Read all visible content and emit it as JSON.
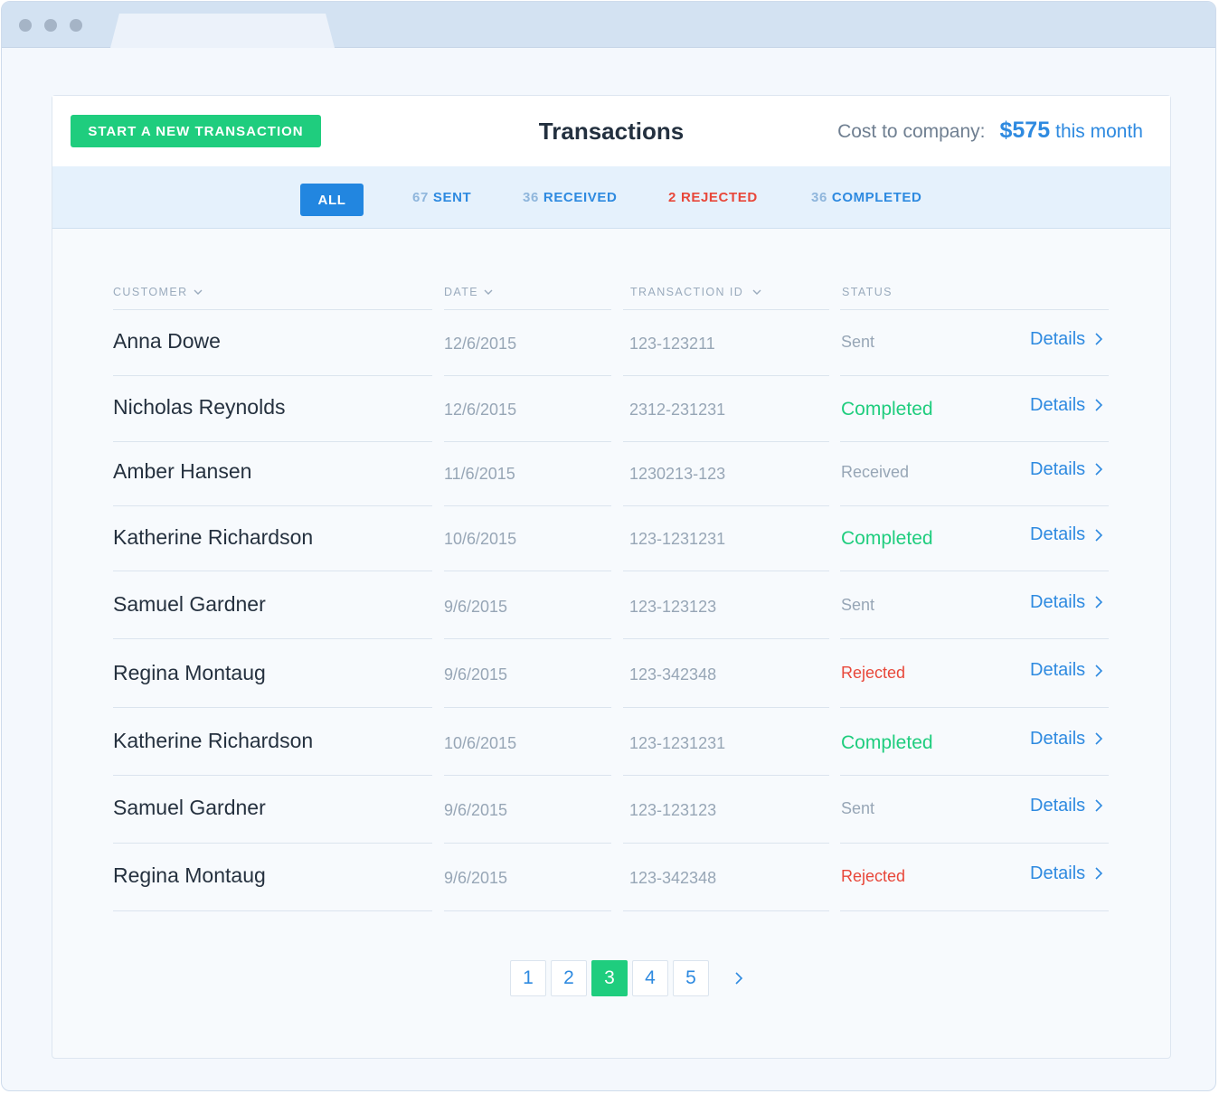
{
  "header": {
    "new_button": "START A NEW TRANSACTION",
    "title": "Transactions",
    "cost_label": "Cost to company:",
    "cost_amount": "$575",
    "cost_suffix": "this month"
  },
  "filters": {
    "all": "ALL",
    "sent": {
      "count": "67",
      "label": "SENT"
    },
    "received": {
      "count": "36",
      "label": "RECEIVED"
    },
    "rejected": {
      "count": "2",
      "label": "REJECTED"
    },
    "completed": {
      "count": "36",
      "label": "COMPLETED"
    }
  },
  "table": {
    "columns": {
      "customer": "CUSTOMER",
      "date": "DATE",
      "transaction_id": "TRANSACTION ID",
      "status": "STATUS"
    },
    "details_label": "Details",
    "rows": [
      {
        "customer": "Anna Dowe",
        "date": "12/6/2015",
        "id": "123-123211",
        "status": "Sent"
      },
      {
        "customer": "Nicholas Reynolds",
        "date": "12/6/2015",
        "id": "2312-231231",
        "status": "Completed"
      },
      {
        "customer": "Amber Hansen",
        "date": "11/6/2015",
        "id": "1230213-123",
        "status": "Received"
      },
      {
        "customer": "Katherine Richardson",
        "date": "10/6/2015",
        "id": "123-1231231",
        "status": "Completed"
      },
      {
        "customer": "Samuel Gardner",
        "date": "9/6/2015",
        "id": "123-123123",
        "status": "Sent"
      },
      {
        "customer": "Regina Montaug",
        "date": "9/6/2015",
        "id": "123-342348",
        "status": "Rejected"
      },
      {
        "customer": "Katherine Richardson",
        "date": "10/6/2015",
        "id": "123-1231231",
        "status": "Completed"
      },
      {
        "customer": "Samuel Gardner",
        "date": "9/6/2015",
        "id": "123-123123",
        "status": "Sent"
      },
      {
        "customer": "Regina Montaug",
        "date": "9/6/2015",
        "id": "123-342348",
        "status": "Rejected"
      }
    ]
  },
  "pagination": {
    "pages": [
      "1",
      "2",
      "3",
      "4",
      "5"
    ],
    "current": "3"
  },
  "colors": {
    "accent_blue": "#2e8ae0",
    "accent_green": "#1fcd7e",
    "rejected_red": "#e8473a",
    "muted": "#97a6b6"
  },
  "icons": {
    "sort": "chevron-down-icon",
    "details": "chevron-right-icon",
    "next_page": "chevron-right-icon"
  }
}
